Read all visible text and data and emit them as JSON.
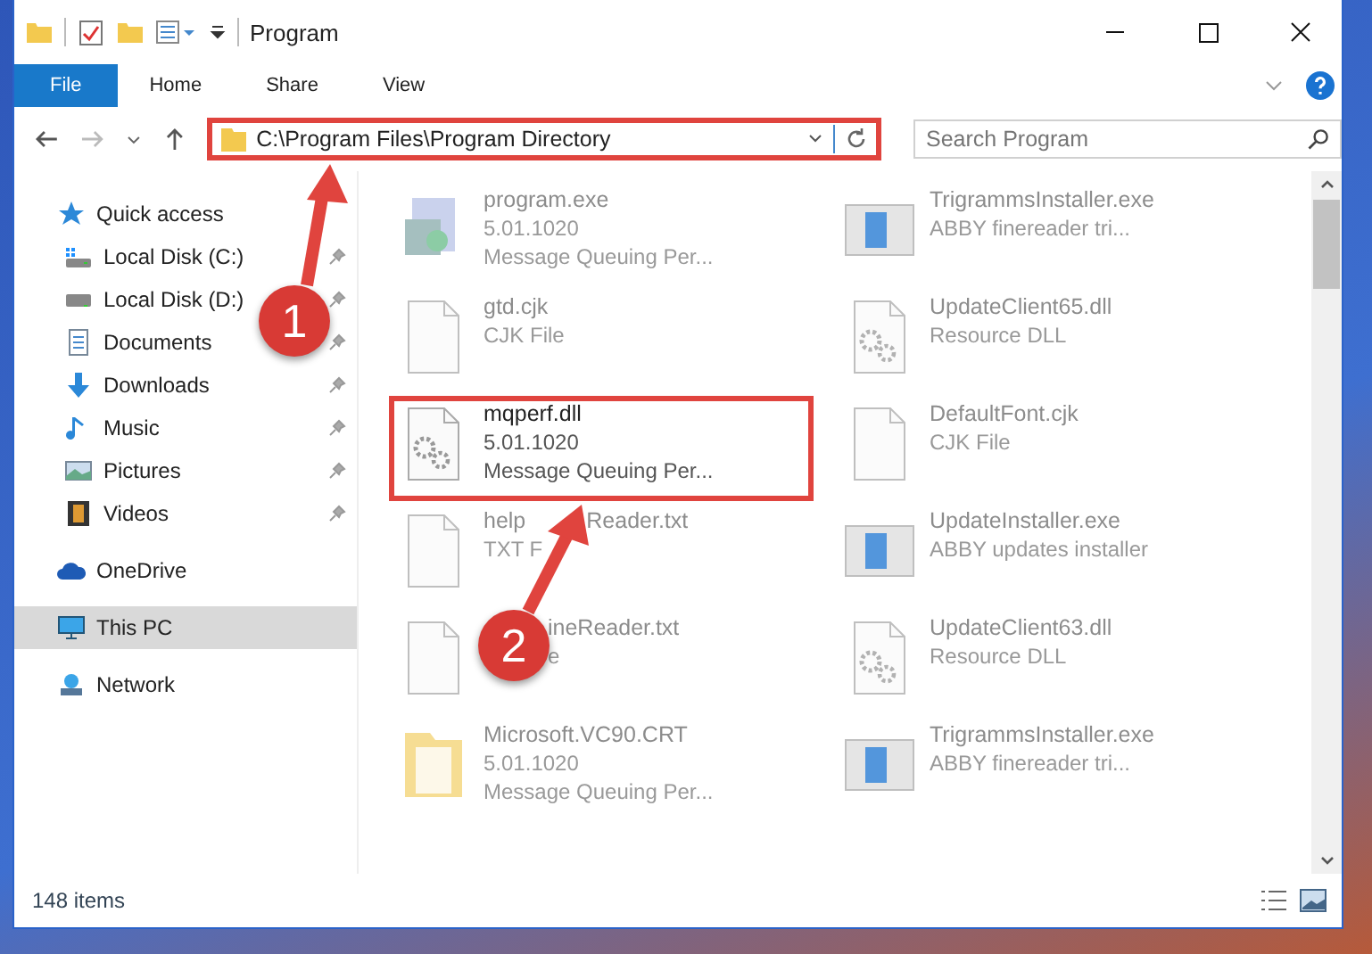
{
  "window": {
    "title": "Program"
  },
  "ribbon_tabs": [
    {
      "label": "File",
      "selected": true
    },
    {
      "label": "Home",
      "selected": false
    },
    {
      "label": "Share",
      "selected": false
    },
    {
      "label": "View",
      "selected": false
    }
  ],
  "address_bar": {
    "path": "C:\\Program Files\\Program Directory",
    "highlighted": true
  },
  "search": {
    "placeholder": "Search Program"
  },
  "nav": [
    {
      "label": "Quick access",
      "kind": "star",
      "pinned": false,
      "selected": false,
      "group": true
    },
    {
      "label": "Local Disk (C:)",
      "kind": "drive-c",
      "pinned": true,
      "selected": false,
      "group": false
    },
    {
      "label": "Local Disk (D:)",
      "kind": "drive",
      "pinned": true,
      "selected": false,
      "group": false
    },
    {
      "label": "Documents",
      "kind": "docs",
      "pinned": true,
      "selected": false,
      "group": false
    },
    {
      "label": "Downloads",
      "kind": "download",
      "pinned": true,
      "selected": false,
      "group": false
    },
    {
      "label": "Music",
      "kind": "music",
      "pinned": true,
      "selected": false,
      "group": false
    },
    {
      "label": "Pictures",
      "kind": "pictures",
      "pinned": true,
      "selected": false,
      "group": false
    },
    {
      "label": "Videos",
      "kind": "videos",
      "pinned": true,
      "selected": false,
      "group": false
    },
    {
      "label": "OneDrive",
      "kind": "cloud",
      "pinned": false,
      "selected": false,
      "group": true
    },
    {
      "label": "This PC",
      "kind": "pc",
      "pinned": false,
      "selected": true,
      "group": true
    },
    {
      "label": "Network",
      "kind": "network",
      "pinned": false,
      "selected": false,
      "group": true
    }
  ],
  "files": [
    {
      "name_parts": [
        "program.exe"
      ],
      "lines": [
        "5.01.1020",
        "Message Queuing Per..."
      ],
      "kind": "exe",
      "blurred": true,
      "highlighted": false,
      "covered": false
    },
    {
      "name_parts": [
        "TrigrammsInstaller.exe"
      ],
      "lines": [
        "ABBY finereader tri..."
      ],
      "kind": "installer",
      "blurred": true,
      "highlighted": false,
      "covered": false
    },
    {
      "name_parts": [
        "gtd.cjk"
      ],
      "lines": [
        "CJK File"
      ],
      "kind": "doc",
      "blurred": true,
      "highlighted": false,
      "covered": false
    },
    {
      "name_parts": [
        "UpdateClient65.dll"
      ],
      "lines": [
        "Resource DLL"
      ],
      "kind": "dll",
      "blurred": true,
      "highlighted": false,
      "covered": false
    },
    {
      "name_parts": [
        "mqperf.dll"
      ],
      "lines": [
        "5.01.1020",
        "Message Queuing Per..."
      ],
      "kind": "dll",
      "blurred": false,
      "highlighted": true,
      "covered": false
    },
    {
      "name_parts": [
        "DefaultFont.cjk"
      ],
      "lines": [
        "CJK File"
      ],
      "kind": "doc",
      "blurred": true,
      "highlighted": false,
      "covered": false
    },
    {
      "name_parts": [
        "help",
        "Reader.txt"
      ],
      "lines": [
        "TXT F"
      ],
      "kind": "doc",
      "blurred": true,
      "highlighted": false,
      "covered": false
    },
    {
      "name_parts": [
        "UpdateInstaller.exe"
      ],
      "lines": [
        "ABBY updates installer"
      ],
      "kind": "installer",
      "blurred": true,
      "highlighted": false,
      "covered": false
    },
    {
      "name_parts": [
        "ineReader.txt"
      ],
      "lines": [
        "e"
      ],
      "kind": "doc",
      "blurred": true,
      "highlighted": false,
      "covered": true
    },
    {
      "name_parts": [
        "UpdateClient63.dll"
      ],
      "lines": [
        "Resource DLL"
      ],
      "kind": "dll",
      "blurred": true,
      "highlighted": false,
      "covered": false
    },
    {
      "name_parts": [
        "Microsoft.VC90.CRT"
      ],
      "lines": [
        "5.01.1020",
        "Message Queuing Per..."
      ],
      "kind": "folder",
      "blurred": true,
      "highlighted": false,
      "covered": false
    },
    {
      "name_parts": [
        "TrigrammsInstaller.exe"
      ],
      "lines": [
        "ABBY finereader tri..."
      ],
      "kind": "installer",
      "blurred": true,
      "highlighted": false,
      "covered": false
    }
  ],
  "status_bar": {
    "count": "148 items"
  },
  "annotations": [
    {
      "label": "1"
    },
    {
      "label": "2"
    }
  ]
}
